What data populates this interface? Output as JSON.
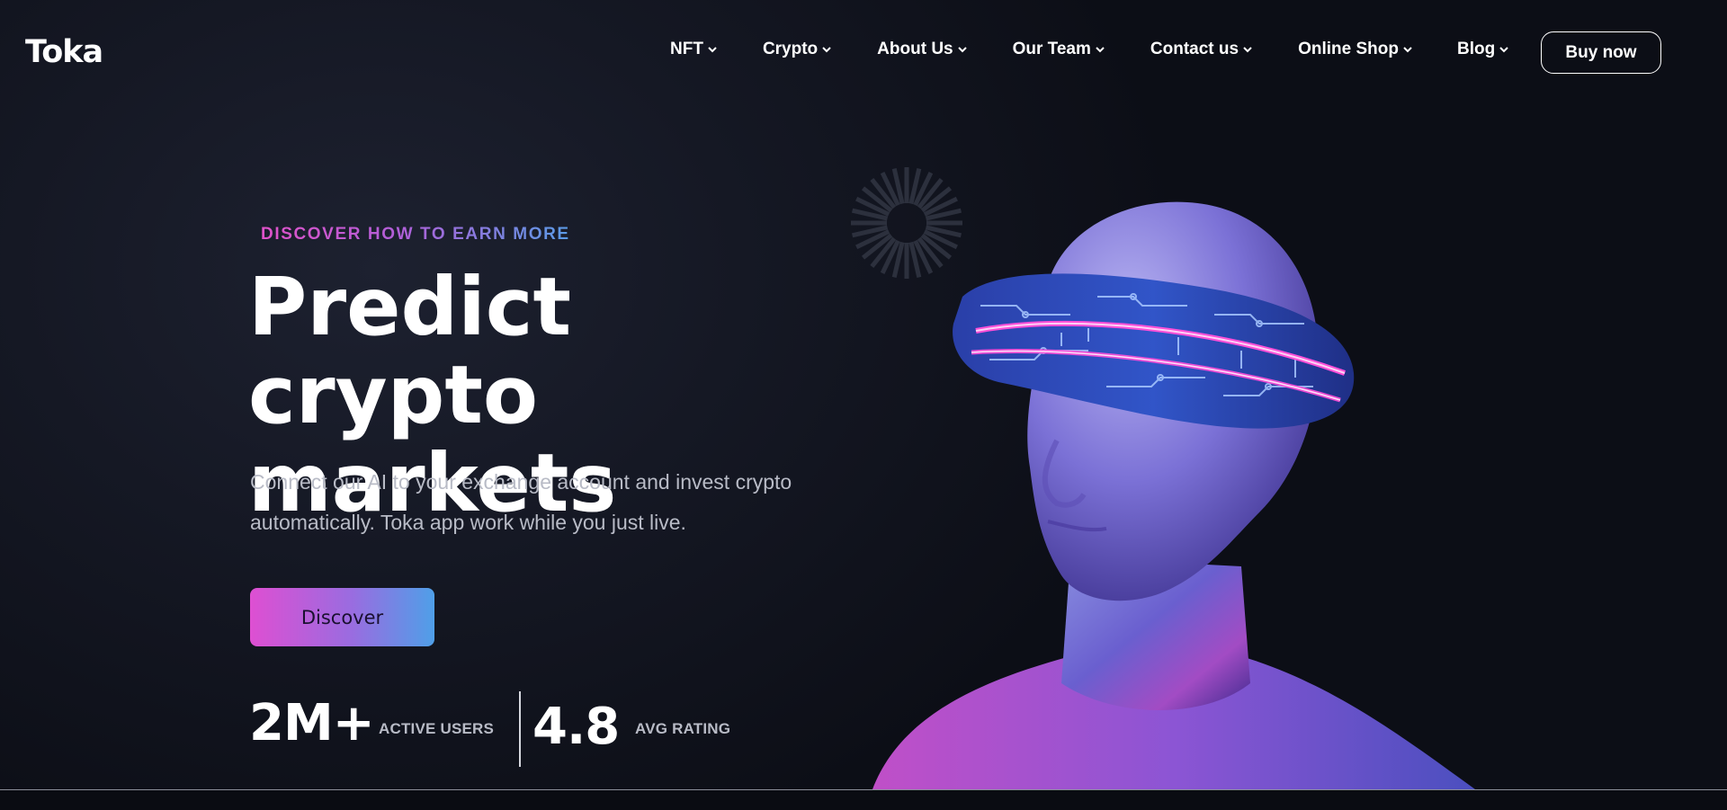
{
  "header": {
    "logo": "Toka",
    "nav": [
      {
        "label": "NFT"
      },
      {
        "label": "Crypto"
      },
      {
        "label": "About Us"
      },
      {
        "label": "Our Team"
      },
      {
        "label": "Contact us"
      },
      {
        "label": "Online Shop"
      },
      {
        "label": "Blog"
      }
    ],
    "cta_label": "Buy now"
  },
  "hero": {
    "eyebrow": "DISCOVER HOW TO EARN MORE",
    "headline_line1": "Predict crypto",
    "headline_line2": "markets",
    "subtext_line1": "Connect our AI to your exchange account and invest crypto",
    "subtext_line2": "automatically. Toka app work while you just live.",
    "button_label": "Discover"
  },
  "stats": [
    {
      "value": "2M+",
      "label": "ACTIVE USERS"
    },
    {
      "value": "4.8",
      "label": "AVG RATING"
    }
  ],
  "icons": {
    "nav_dropdown": "chevron-down-icon",
    "loader": "loading-spinner-icon"
  },
  "colors": {
    "background": "#151824",
    "accent_pink": "#de4fd2",
    "accent_blue": "#4f9fe8",
    "text_muted": "#b8bbc6"
  }
}
